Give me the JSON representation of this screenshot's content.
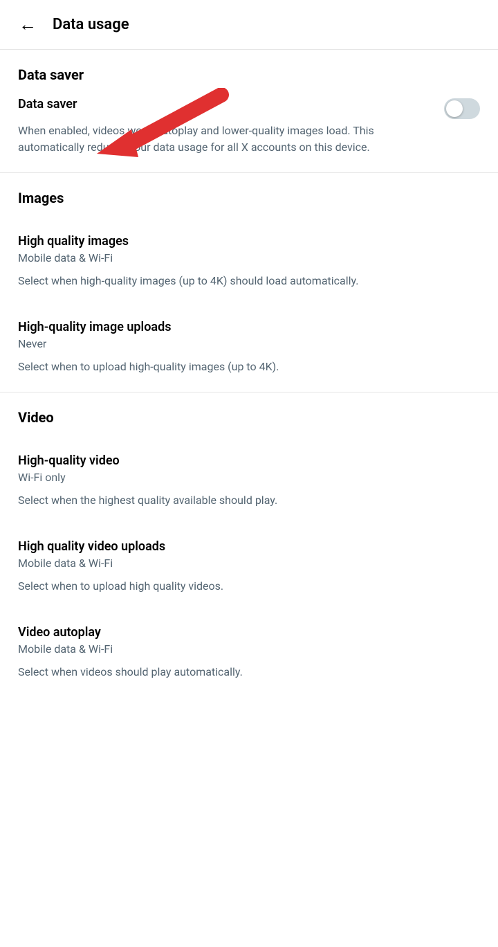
{
  "header": {
    "title": "Data usage",
    "back_label": "←"
  },
  "sections": {
    "data_saver": {
      "title": "Data saver",
      "setting": {
        "name": "Data saver",
        "description": "When enabled, videos won't autoplay and lower-quality images load. This automatically reduces your data usage for all X accounts on this device.",
        "toggle_state": "off"
      }
    },
    "images": {
      "title": "Images",
      "settings": [
        {
          "name": "High quality images",
          "value": "Mobile data & Wi-Fi",
          "description": "Select when high-quality images (up to 4K) should load automatically."
        },
        {
          "name": "High-quality image uploads",
          "value": "Never",
          "description": "Select when to upload high-quality images (up to 4K)."
        }
      ]
    },
    "video": {
      "title": "Video",
      "settings": [
        {
          "name": "High-quality video",
          "value": "Wi-Fi only",
          "description": "Select when the highest quality available should play."
        },
        {
          "name": "High quality video uploads",
          "value": "Mobile data & Wi-Fi",
          "description": "Select when to upload high quality videos."
        },
        {
          "name": "Video autoplay",
          "value": "Mobile data & Wi-Fi",
          "description": "Select when videos should play automatically."
        }
      ]
    }
  }
}
